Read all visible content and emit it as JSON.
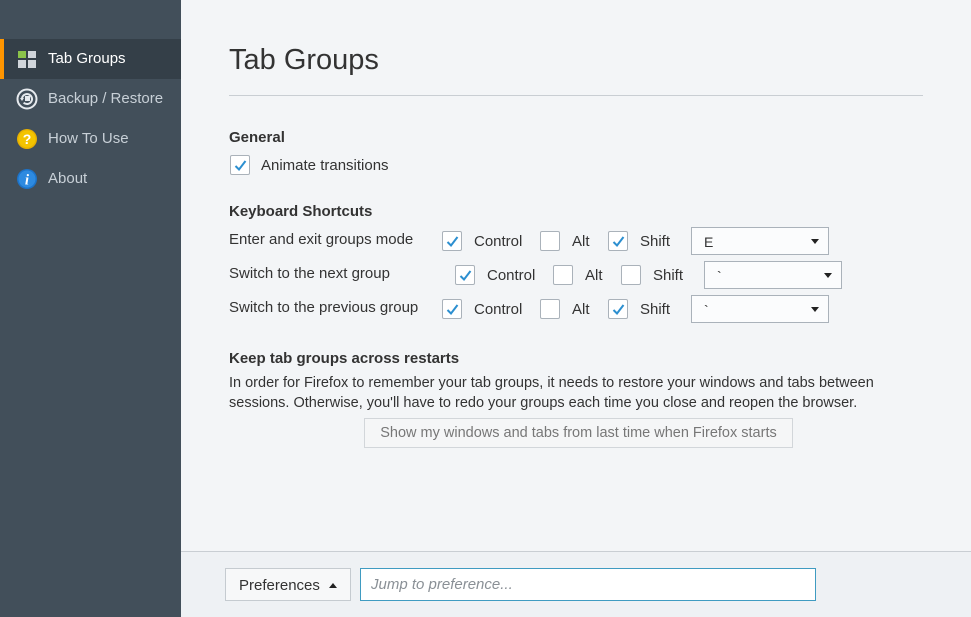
{
  "sidebar": {
    "items": [
      {
        "label": "Tab Groups",
        "icon": "tab-groups-icon",
        "active": true
      },
      {
        "label": "Backup / Restore",
        "icon": "backup-restore-icon"
      },
      {
        "label": "How To Use",
        "icon": "help-icon"
      },
      {
        "label": "About",
        "icon": "info-icon"
      }
    ]
  },
  "main": {
    "title": "Tab Groups",
    "general": {
      "heading": "General",
      "animate_label": "Animate transitions",
      "animate_checked": true
    },
    "shortcuts": {
      "heading": "Keyboard Shortcuts",
      "rows": [
        {
          "label": "Enter and exit groups mode",
          "control": "Control",
          "alt": "Alt",
          "shift": "Shift",
          "control_checked": true,
          "alt_checked": false,
          "shift_checked": true,
          "key": "E"
        },
        {
          "label": "Switch to the next group",
          "control": "Control",
          "alt": "Alt",
          "shift": "Shift",
          "control_checked": true,
          "alt_checked": false,
          "shift_checked": false,
          "key": "`"
        },
        {
          "label": "Switch to the previous group",
          "control": "Control",
          "alt": "Alt",
          "shift": "Shift",
          "control_checked": true,
          "alt_checked": false,
          "shift_checked": true,
          "key": "`"
        }
      ]
    },
    "restarts": {
      "heading": "Keep tab groups across restarts",
      "paragraph": "In order for Firefox to remember your tab groups, it needs to restore your windows and tabs between sessions. Otherwise, you'll have to redo your groups each time you close and reopen the browser.",
      "button": "Show my windows and tabs from last time when Firefox starts"
    }
  },
  "footer": {
    "preferences_label": "Preferences",
    "search_placeholder": "Jump to preference..."
  },
  "colors": {
    "sidebar_bg": "#424f5a",
    "accent": "#ff9500",
    "check": "#2c8fd0",
    "focus": "#3f9bc1"
  }
}
